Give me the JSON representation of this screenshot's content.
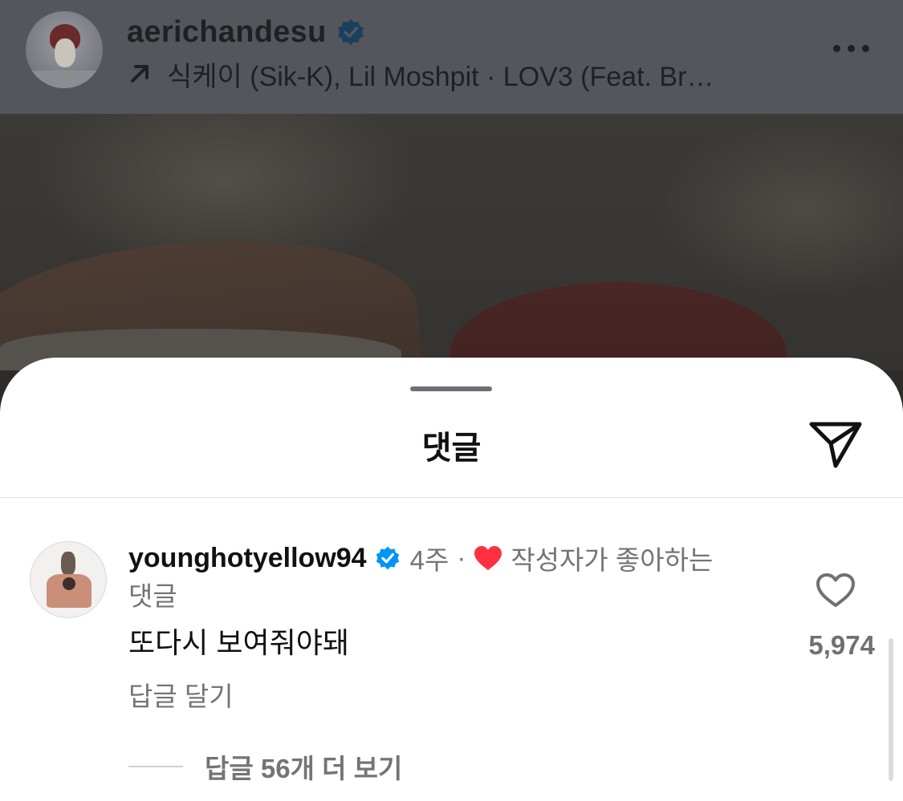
{
  "post_header": {
    "username": "aerichandesu",
    "verified": true,
    "music": "식케이 (Sik-K), Lil Moshpit · LOV3 (Feat. Br…",
    "icons": {
      "avatar": "profile-avatar",
      "verified": "verified-badge-icon",
      "music": "arrow-up-right-icon",
      "more": "more-options-icon"
    }
  },
  "comments_sheet": {
    "title": "댓글",
    "icons": {
      "share": "paper-plane-icon"
    },
    "comment": {
      "username": "younghotyellow94",
      "verified": true,
      "time": "4주",
      "separator": "·",
      "creator_liked_label": "작성자가 좋아하는",
      "creator_liked_label_cont": "댓글",
      "text": "또다시 보여줘야돼",
      "reply_label": "답글 달기",
      "like_count": "5,974",
      "view_replies_label": "답글 56개 더 보기"
    }
  },
  "colors": {
    "verified_blue": "#0095f6",
    "liked_red": "#ff3040",
    "muted_text": "#737478",
    "primary_text": "#111111"
  }
}
